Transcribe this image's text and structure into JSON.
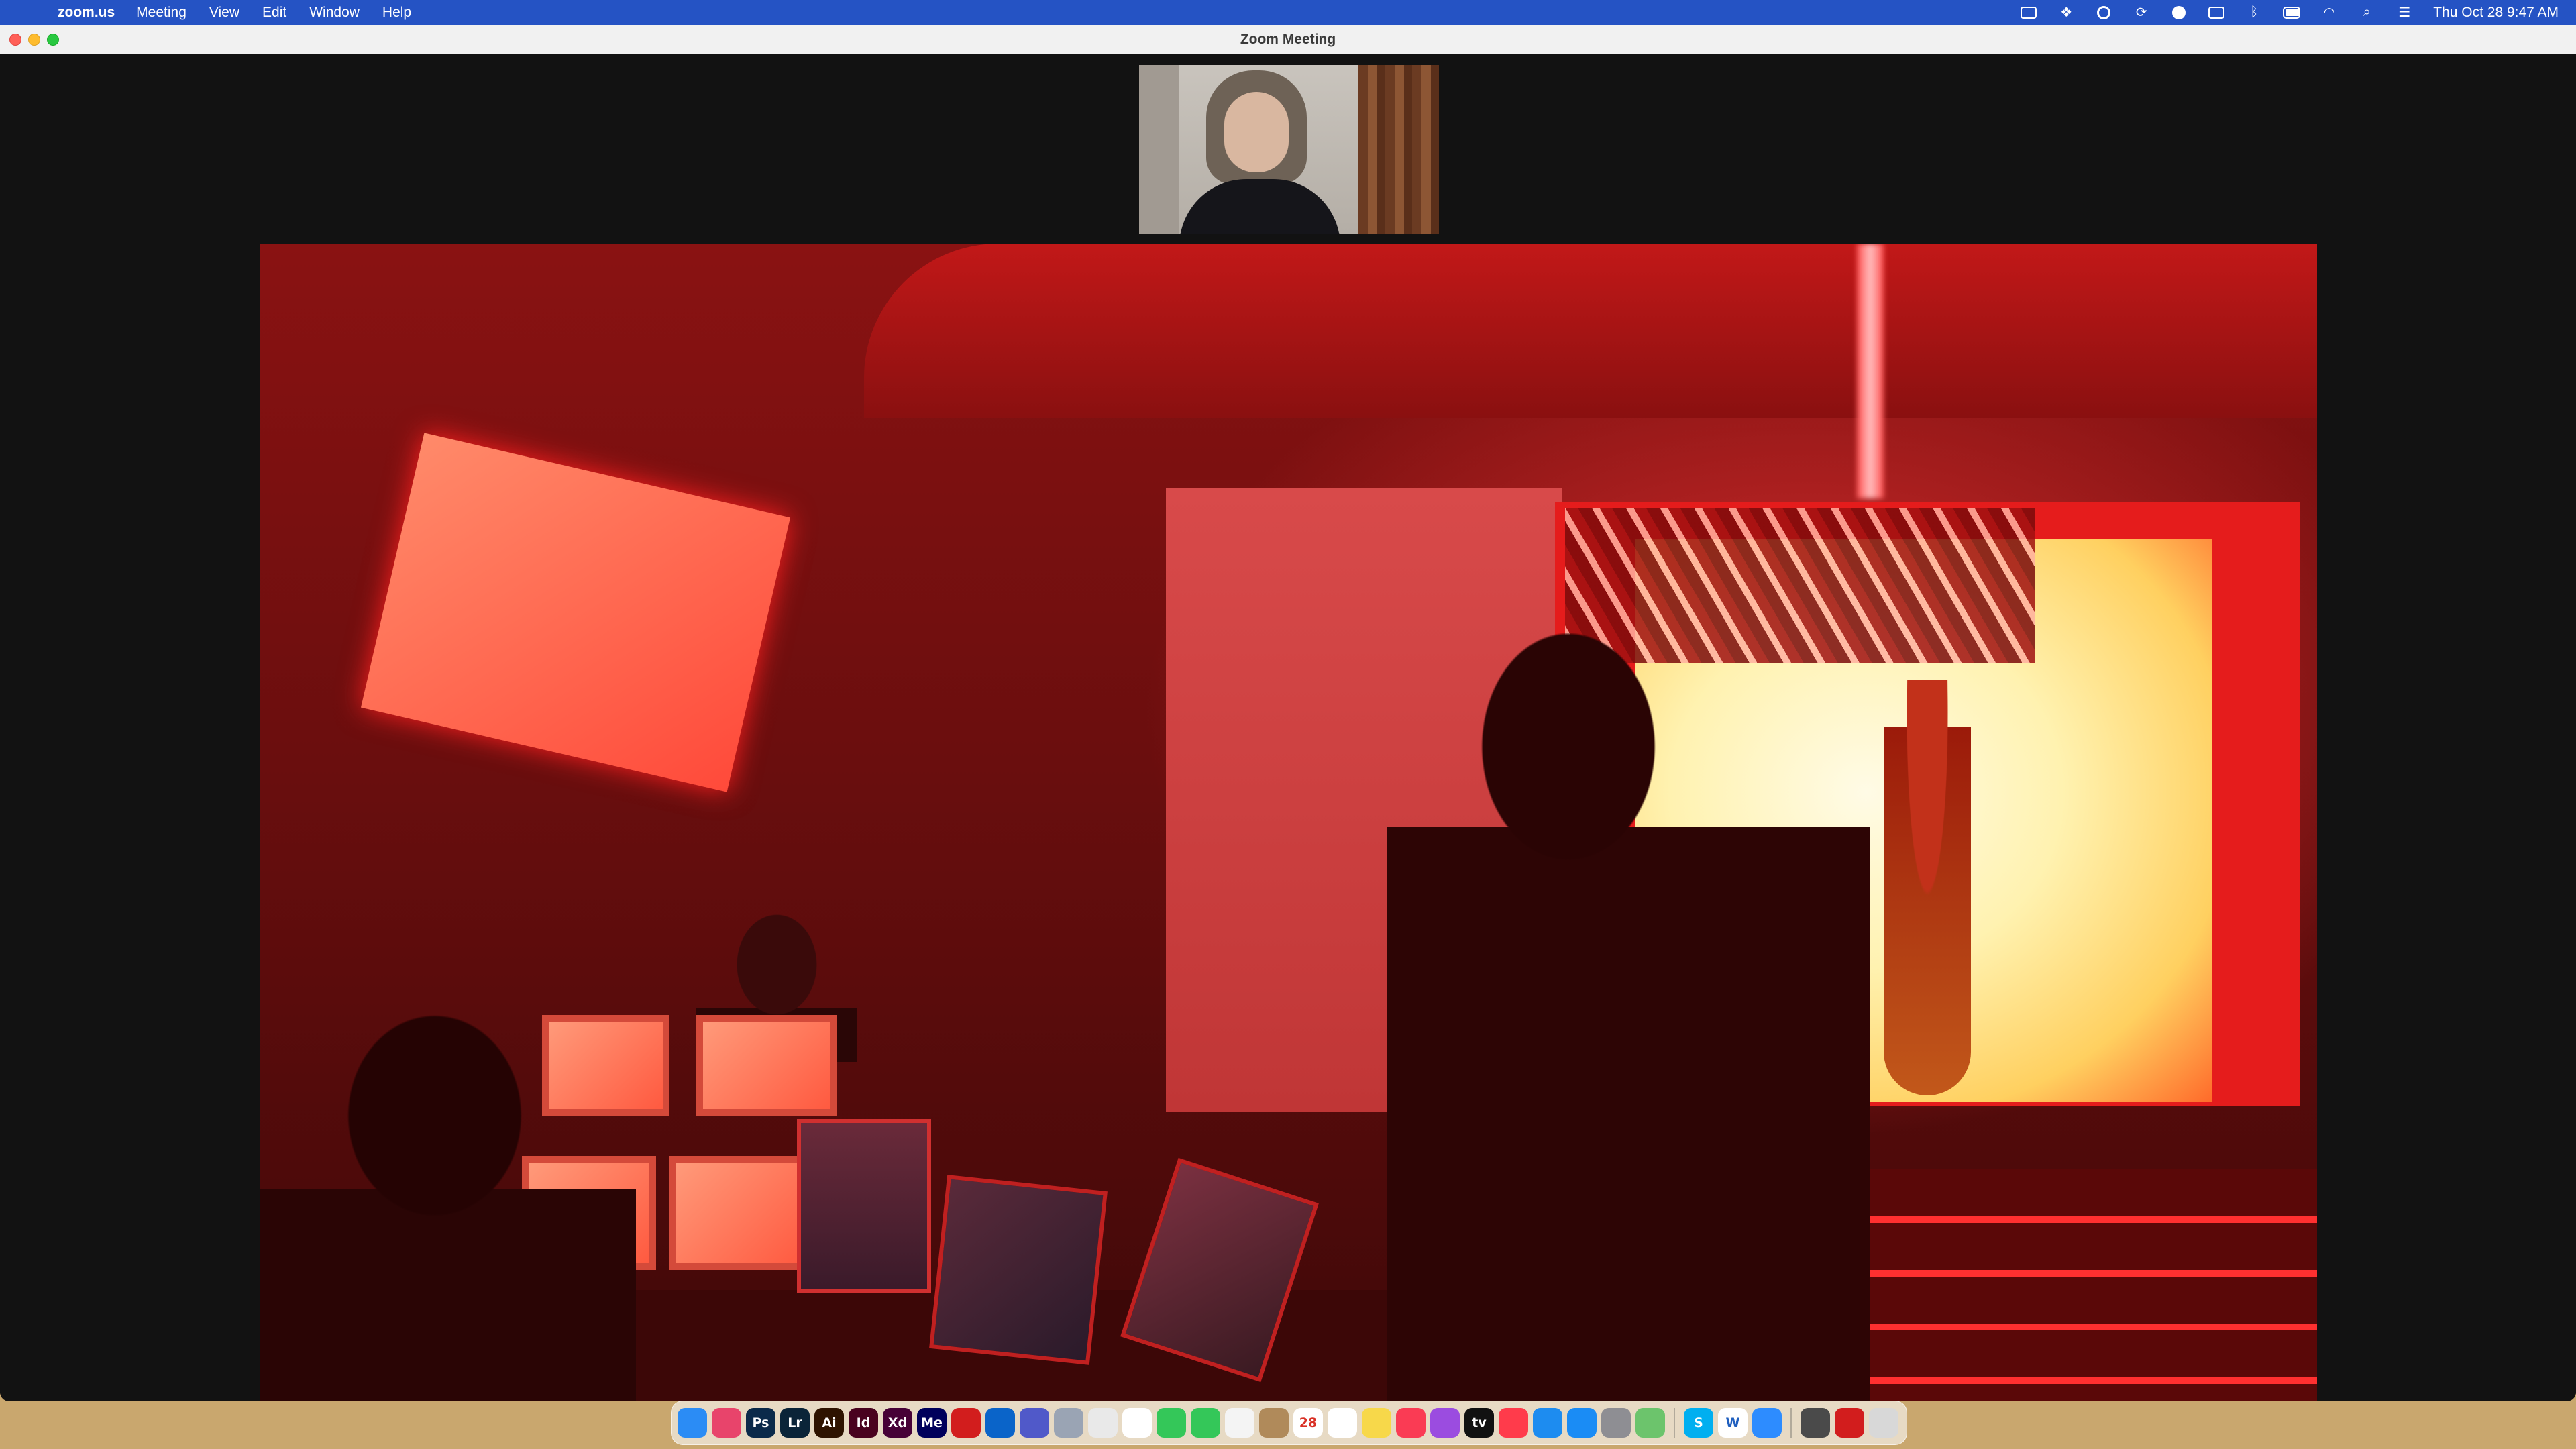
{
  "menubar": {
    "apple_glyph": "",
    "app_name": "zoom.us",
    "menus": [
      "Meeting",
      "View",
      "Edit",
      "Window",
      "Help"
    ],
    "clock": "Thu Oct 28  9:47 AM",
    "status_icons": [
      "zoom-status-icon",
      "dropbox-icon",
      "creative-cloud-icon",
      "sync-icon",
      "app-status-icon",
      "display-icon",
      "bluetooth-icon",
      "battery-icon",
      "wifi-icon",
      "spotlight-icon",
      "control-center-icon"
    ]
  },
  "window": {
    "title": "Zoom Meeting",
    "background": "#121212"
  },
  "dock": {
    "items": [
      {
        "name": "finder-icon",
        "label": "",
        "color": "#2b8cf5"
      },
      {
        "name": "creative-cloud-dock-icon",
        "label": "",
        "color": "#e8446b"
      },
      {
        "name": "photoshop-icon",
        "label": "Ps",
        "color": "#0b2a4a"
      },
      {
        "name": "lightroom-icon",
        "label": "Lr",
        "color": "#0a2438"
      },
      {
        "name": "illustrator-icon",
        "label": "Ai",
        "color": "#2e1300"
      },
      {
        "name": "indesign-icon",
        "label": "Id",
        "color": "#49021f"
      },
      {
        "name": "xd-icon",
        "label": "Xd",
        "color": "#470137"
      },
      {
        "name": "media-encoder-icon",
        "label": "Me",
        "color": "#00005b"
      },
      {
        "name": "acrobat-icon",
        "label": "",
        "color": "#d21d1d"
      },
      {
        "name": "outlook-icon",
        "label": "",
        "color": "#0a64c9"
      },
      {
        "name": "teams-icon",
        "label": "",
        "color": "#5059c9"
      },
      {
        "name": "launchpad-icon",
        "label": "",
        "color": "#9aa4b4"
      },
      {
        "name": "chrome-icon",
        "label": "",
        "color": "#e9e9e9"
      },
      {
        "name": "slack-icon",
        "label": "",
        "color": "#ffffff"
      },
      {
        "name": "facetime-icon",
        "label": "",
        "color": "#34c759"
      },
      {
        "name": "messages-icon",
        "label": "",
        "color": "#34c759"
      },
      {
        "name": "photos-icon",
        "label": "",
        "color": "#f4f4f4"
      },
      {
        "name": "contacts-icon",
        "label": "",
        "color": "#b08a5a"
      },
      {
        "name": "calendar-icon",
        "label": "28",
        "color": "#ffffff"
      },
      {
        "name": "reminders-icon",
        "label": "",
        "color": "#ffffff"
      },
      {
        "name": "notes-icon",
        "label": "",
        "color": "#f7d84a"
      },
      {
        "name": "music-icon",
        "label": "",
        "color": "#fa3b54"
      },
      {
        "name": "podcasts-icon",
        "label": "",
        "color": "#9b4ce0"
      },
      {
        "name": "tv-icon",
        "label": "tv",
        "color": "#111111"
      },
      {
        "name": "news-icon",
        "label": "",
        "color": "#ff3b4b"
      },
      {
        "name": "keynote-icon",
        "label": "",
        "color": "#1d8cf0"
      },
      {
        "name": "app-store-icon",
        "label": "",
        "color": "#1a8cf5"
      },
      {
        "name": "system-preferences-icon",
        "label": "",
        "color": "#8e8e93"
      },
      {
        "name": "maps-icon",
        "label": "",
        "color": "#6cc46c"
      },
      {
        "name": "skype-icon",
        "label": "S",
        "color": "#00aff0"
      },
      {
        "name": "word-icon",
        "label": "W",
        "color": "#ffffff"
      },
      {
        "name": "zoom-dock-icon",
        "label": "",
        "color": "#2d8cff"
      },
      {
        "name": "preview-stack-icon",
        "label": "",
        "color": "#4a4a4a"
      },
      {
        "name": "acrobat-stack-icon",
        "label": "",
        "color": "#d21d1d"
      },
      {
        "name": "trash-icon",
        "label": "",
        "color": "#d8d8d8"
      }
    ]
  }
}
